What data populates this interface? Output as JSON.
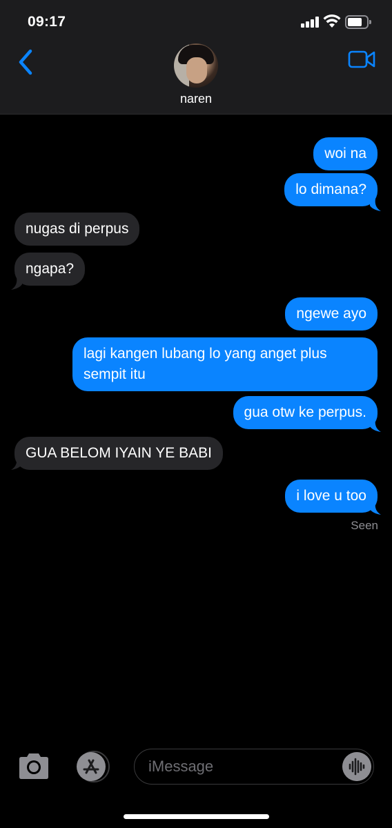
{
  "status_bar": {
    "time": "09:17",
    "battery_icon": "battery-icon",
    "wifi_icon": "wifi-icon",
    "signal_icon": "signal-icon"
  },
  "header": {
    "contact_name": "naren",
    "back_icon": "chevron-left-icon",
    "video_icon": "video-camera-icon",
    "accent_color": "#0a84ff"
  },
  "messages": [
    {
      "from": "me",
      "text": "woi na"
    },
    {
      "from": "me",
      "text": "lo dimana?"
    },
    {
      "from": "them",
      "text": "nugas di perpus"
    },
    {
      "from": "them",
      "text": "ngapa?"
    },
    {
      "from": "me",
      "text": "ngewe ayo"
    },
    {
      "from": "me",
      "text_line1": "lagi kangen lubang lo yang anget plus",
      "text_line2": "sempit itu"
    },
    {
      "from": "me",
      "text": "gua otw ke perpus."
    },
    {
      "from": "them",
      "text": "GUA BELOM IYAIN YE BABI"
    },
    {
      "from": "me",
      "text": "i love u too"
    }
  ],
  "read_receipt": "Seen",
  "composer": {
    "placeholder": "iMessage",
    "camera_icon": "camera-icon",
    "apps_icon": "app-store-icon",
    "audio_icon": "audio-waveform-icon"
  },
  "colors": {
    "sent_bubble": "#0a84ff",
    "received_bubble": "#262629",
    "background": "#000000"
  }
}
